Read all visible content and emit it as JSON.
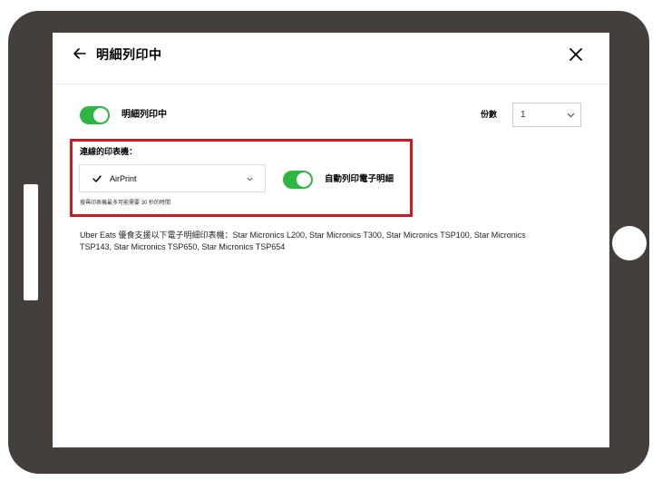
{
  "header": {
    "title": "明細列印中",
    "back_icon": "arrow-left-icon",
    "close_icon": "close-icon"
  },
  "receipt_printing": {
    "label": "明細列印中",
    "enabled": true,
    "copies_label": "份數",
    "copies_value": "1"
  },
  "connected_printer": {
    "section_label": "連線的印表機：",
    "selected_printer": "AirPrint",
    "auto_print_label": "自動列印電子明細",
    "auto_print_enabled": true,
    "search_note": "搜尋印表機最多可能需要 30 秒的時間"
  },
  "info": {
    "supported_printers": "Uber Eats 優食支援以下電子明細印表機：Star Micronics L200, Star Micronics T300, Star Micronics TSP100, Star Micronics TSP143, Star Micronics TSP650, Star Micronics TSP654"
  },
  "colors": {
    "toggle_on": "#2fb544",
    "highlight": "#d11a1f",
    "tablet_frame": "#453f3c"
  }
}
